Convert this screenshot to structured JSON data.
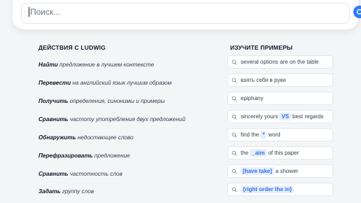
{
  "search": {
    "placeholder": "Поиск..."
  },
  "actions": {
    "title": "ДЕЙСТВИЯ С LUDWIG",
    "items": [
      {
        "verb": "Найти",
        "rest": "предложение в лучшем контексте"
      },
      {
        "verb": "Перевести",
        "rest": "на английский язык лучшим образом"
      },
      {
        "verb": "Получить",
        "rest": "определения, синонимы и примеры"
      },
      {
        "verb": "Сравнить",
        "rest": "частоту употребления двух предложений"
      },
      {
        "verb": "Обнаружить",
        "rest": "недостающее слово"
      },
      {
        "verb": "Перефразировать",
        "rest": "предложение"
      },
      {
        "verb": "Сравнить",
        "rest": "частотность слов"
      },
      {
        "verb": "Задать",
        "rest": "группу слов"
      }
    ]
  },
  "examples": {
    "title": "ИЗУЧИТЕ ПРИМЕРЫ",
    "items": [
      {
        "before": "several options are on the table",
        "token": "",
        "after": ""
      },
      {
        "before": "взять себя в руки",
        "token": "",
        "after": ""
      },
      {
        "before": "epiphany",
        "token": "",
        "after": ""
      },
      {
        "before": "sincerely yours",
        "token": "VS",
        "after": "best regards"
      },
      {
        "before": "find the",
        "token": "*",
        "after": "word"
      },
      {
        "before": "the",
        "token": "_aim",
        "after": "of this paper"
      },
      {
        "before": "",
        "token": "[have take]",
        "after": "a shower"
      },
      {
        "before": "",
        "token": "{right order the in}",
        "after": ""
      }
    ]
  },
  "colors": {
    "accent": "#2f7cf6",
    "token_bg": "#e6efff",
    "token_fg": "#2f6fe0"
  },
  "icons": {
    "search_button": "search-icon",
    "chip": "search-icon"
  }
}
